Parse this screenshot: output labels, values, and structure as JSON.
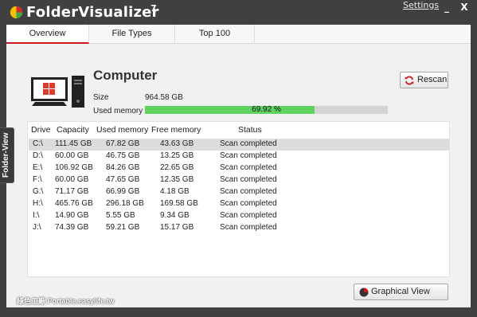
{
  "app": {
    "title": "FolderVisualizer",
    "version": "7",
    "settings_label": "Settings",
    "minimize_label": "_",
    "close_label": "X"
  },
  "tabs": [
    {
      "label": "Overview",
      "active": true
    },
    {
      "label": "File Types",
      "active": false
    },
    {
      "label": "Top 100",
      "active": false
    }
  ],
  "side_tab": {
    "label": "Folder-View"
  },
  "computer": {
    "title": "Computer",
    "size_label": "Size",
    "size_value": "964.58 GB",
    "used_label": "Used memory",
    "used_percent_text": "69.92 %",
    "used_fraction": 0.6992
  },
  "rescan_label": "Rescan",
  "table": {
    "headers": [
      "Drive",
      "Capacity",
      "Used memory",
      "Free memory",
      "Status"
    ],
    "rows": [
      {
        "drive": "C:\\",
        "capacity": "111.45 GB",
        "used": "67.82 GB",
        "free": "43.63 GB",
        "status": "Scan completed",
        "selected": true
      },
      {
        "drive": "D:\\",
        "capacity": "60.00 GB",
        "used": "46.75 GB",
        "free": "13.25 GB",
        "status": "Scan completed"
      },
      {
        "drive": "E:\\",
        "capacity": "106.92 GB",
        "used": "84.26 GB",
        "free": "22.65 GB",
        "status": "Scan completed"
      },
      {
        "drive": "F:\\",
        "capacity": "60.00 GB",
        "used": "47.65 GB",
        "free": "12.35 GB",
        "status": "Scan completed"
      },
      {
        "drive": "G:\\",
        "capacity": "71.17 GB",
        "used": "66.99 GB",
        "free": "4.18 GB",
        "status": "Scan completed"
      },
      {
        "drive": "H:\\",
        "capacity": "465.76 GB",
        "used": "296.18 GB",
        "free": "169.58 GB",
        "status": "Scan completed"
      },
      {
        "drive": "I:\\",
        "capacity": "14.90 GB",
        "used": "5.55 GB",
        "free": "9.34 GB",
        "status": "Scan completed"
      },
      {
        "drive": "J:\\",
        "capacity": "74.39 GB",
        "used": "59.21 GB",
        "free": "15.17 GB",
        "status": "Scan completed"
      }
    ]
  },
  "graphical_view_label": "Graphical View",
  "watermark": "綠色工廠 Portable.easylife.tw",
  "colors": {
    "accent_red": "#c8191d",
    "used_bar_green": "#5fd35f",
    "window_bg": "#404040"
  }
}
